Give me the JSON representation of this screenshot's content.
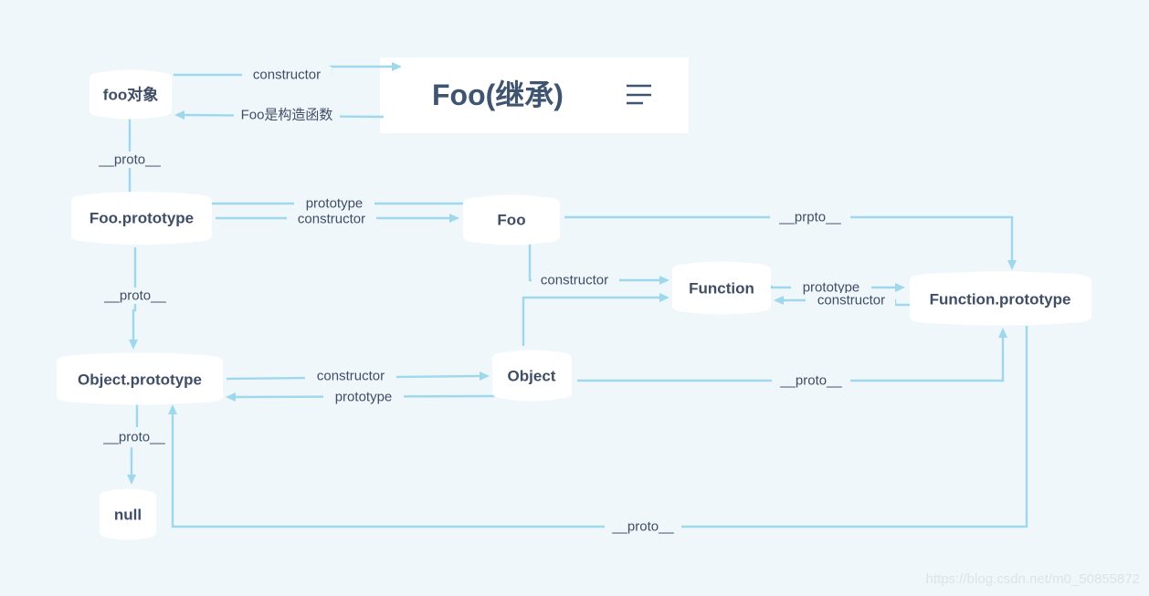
{
  "title": {
    "text": "Foo(继承)",
    "icon": "menu-lines-icon"
  },
  "colors": {
    "background": "#eff7fb",
    "node_fill": "#ffffff",
    "edge": "#9fd8ec",
    "text": "#3f4d66"
  },
  "nodes": [
    {
      "id": "foo_obj",
      "label": "foo对象"
    },
    {
      "id": "foo_proto",
      "label": "Foo.prototype"
    },
    {
      "id": "foo",
      "label": "Foo"
    },
    {
      "id": "function",
      "label": "Function"
    },
    {
      "id": "function_proto",
      "label": "Function.prototype"
    },
    {
      "id": "object_proto",
      "label": "Object.prototype"
    },
    {
      "id": "object",
      "label": "Object"
    },
    {
      "id": "null",
      "label": "null"
    }
  ],
  "edges": [
    {
      "from": "foo_obj",
      "to": "title",
      "label": "constructor"
    },
    {
      "from": "title",
      "to": "foo_obj",
      "label": "Foo是构造函数"
    },
    {
      "from": "foo_obj",
      "to": "foo_proto",
      "label": "__proto__"
    },
    {
      "from": "foo",
      "to": "foo_proto",
      "label": "prototype"
    },
    {
      "from": "foo_proto",
      "to": "foo",
      "label": "constructor"
    },
    {
      "from": "foo",
      "to": "function_proto",
      "label": "__prpto__"
    },
    {
      "from": "foo",
      "to": "function",
      "label": "constructor"
    },
    {
      "from": "object",
      "to": "function",
      "label": ""
    },
    {
      "from": "function",
      "to": "function_proto",
      "label": "prototype"
    },
    {
      "from": "function_proto",
      "to": "function",
      "label": "constructor"
    },
    {
      "from": "foo_proto",
      "to": "object_proto",
      "label": "__proto__"
    },
    {
      "from": "object_proto",
      "to": "object",
      "label": "constructor"
    },
    {
      "from": "object",
      "to": "object_proto",
      "label": "prototype"
    },
    {
      "from": "object",
      "to": "function_proto",
      "label": "__proto__"
    },
    {
      "from": "object_proto",
      "to": "null",
      "label": "__proto__"
    },
    {
      "from": "function_proto",
      "to": "object_proto",
      "label": "__proto__"
    }
  ],
  "watermark": "https://blog.csdn.net/m0_50855872"
}
